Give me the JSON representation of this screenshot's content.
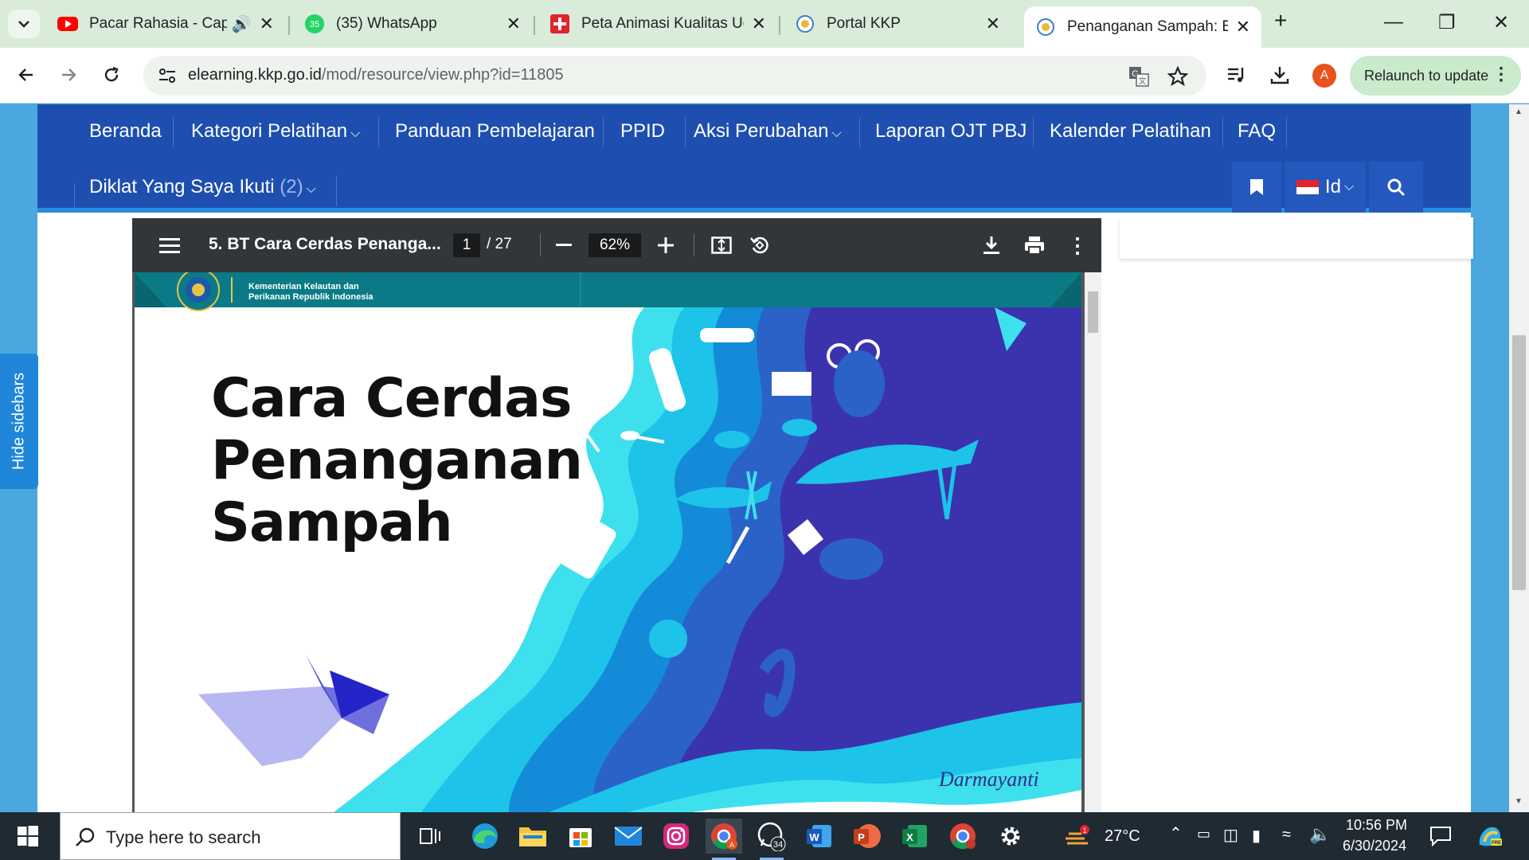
{
  "browser": {
    "tabs": [
      {
        "title": "Pacar Rahasia - Cappu",
        "favicon": "youtube-icon",
        "audio": true
      },
      {
        "title": "(35) WhatsApp",
        "favicon": "whatsapp-icon",
        "badge": "35"
      },
      {
        "title": "Peta Animasi Kualitas Ud",
        "favicon": "red-cross-icon"
      },
      {
        "title": "Portal KKP",
        "favicon": "kkp-icon"
      },
      {
        "title": "Penanganan Sampah: Bal",
        "favicon": "kkp-icon",
        "active": true
      }
    ],
    "url_domain": "elearning.kkp.go.id",
    "url_path": "/mod/resource/view.php?id=11805",
    "avatar_letter": "A",
    "relaunch_label": "Relaunch to update"
  },
  "site_nav": {
    "row1": [
      "Beranda",
      "Kategori Pelatihan",
      "Panduan Pembelajaran",
      "PPID",
      "Aksi Perubahan",
      "Laporan OJT PBJ",
      "Kalender Pelatihan",
      "FAQ"
    ],
    "diklat_label": "Diklat Yang Saya Ikuti",
    "diklat_count": "(2)",
    "language": "Id"
  },
  "sidebar_toggle": "Hide sidebars",
  "pdf": {
    "title": "5. BT Cara Cerdas Penanga...",
    "page": "1",
    "total": "/ 27",
    "zoom": "62%",
    "slide": {
      "org_line1": "Kementerian Kelautan dan",
      "org_line2": "Perikanan  Republik Indonesia",
      "title_line1": "Cara Cerdas",
      "title_line2": "Penanganan",
      "title_line3": "Sampah",
      "author": "Darmayanti"
    }
  },
  "taskbar": {
    "search_placeholder": "Type here to search",
    "whatsapp_badge": "34",
    "weather_temp": "27°C",
    "weather_badge": "1",
    "time": "10:56 PM",
    "date": "6/30/2024"
  },
  "colors": {
    "site_nav": "#1e4fb0",
    "accent_blue": "#1f86da",
    "pdf_toolbar": "#323639",
    "sea_deep": "#3a2fa8",
    "sea_light": "#2fd3e8"
  }
}
